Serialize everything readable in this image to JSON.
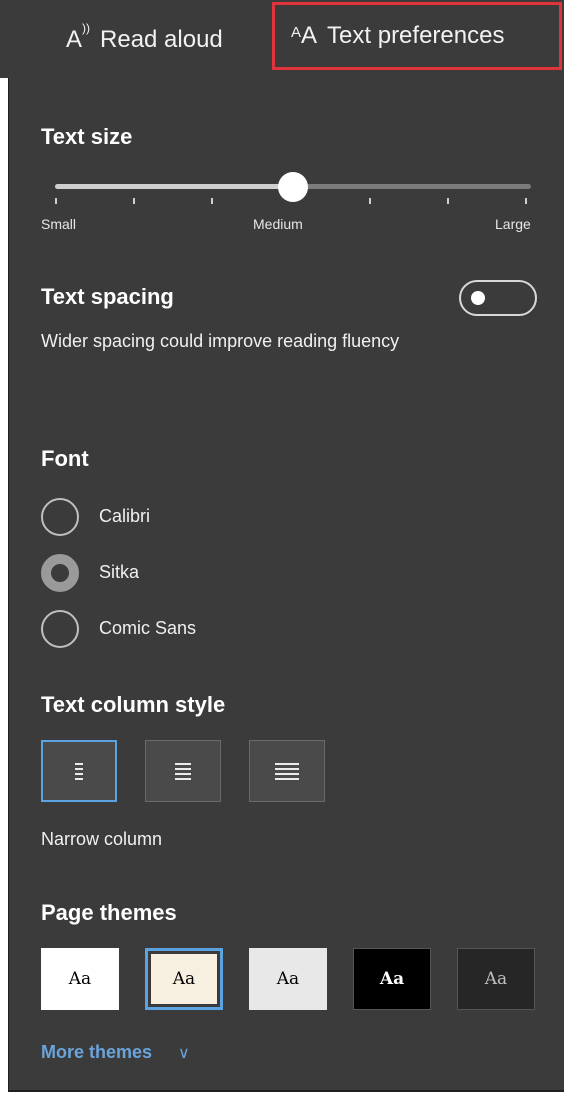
{
  "tabs": [
    {
      "label": "Read aloud",
      "icon": "read-aloud-icon"
    },
    {
      "label": "Text preferences",
      "icon": "text-preferences-icon",
      "highlighted": true
    }
  ],
  "text_size": {
    "heading": "Text size",
    "min_label": "Small",
    "mid_label": "Medium",
    "max_label": "Large",
    "level_fraction": 0.5
  },
  "text_spacing": {
    "heading": "Text spacing",
    "description": "Wider spacing could improve reading fluency",
    "enabled": false
  },
  "font": {
    "heading": "Font",
    "options": [
      "Calibri",
      "Sitka",
      "Comic Sans"
    ],
    "selected": "Sitka"
  },
  "column_style": {
    "heading": "Text column style",
    "options": [
      "narrow",
      "medium",
      "wide"
    ],
    "selected": "narrow",
    "caption": "Narrow column"
  },
  "page_themes": {
    "heading": "Page themes",
    "sample": "Aa",
    "themes": [
      {
        "bg": "#ffffff",
        "fg": "#000000"
      },
      {
        "bg": "#f7f0e1",
        "fg": "#000000",
        "selected": true
      },
      {
        "bg": "#e8e8e8",
        "fg": "#000000"
      },
      {
        "bg": "#000000",
        "fg": "#ffffff"
      },
      {
        "bg": "#262626",
        "fg": "#bfbfbf"
      }
    ],
    "more_label": "More themes"
  },
  "colors": {
    "panel_bg": "#3b3b3b",
    "accent_blue": "#5aa3e0",
    "highlight_red": "#e0343c"
  }
}
